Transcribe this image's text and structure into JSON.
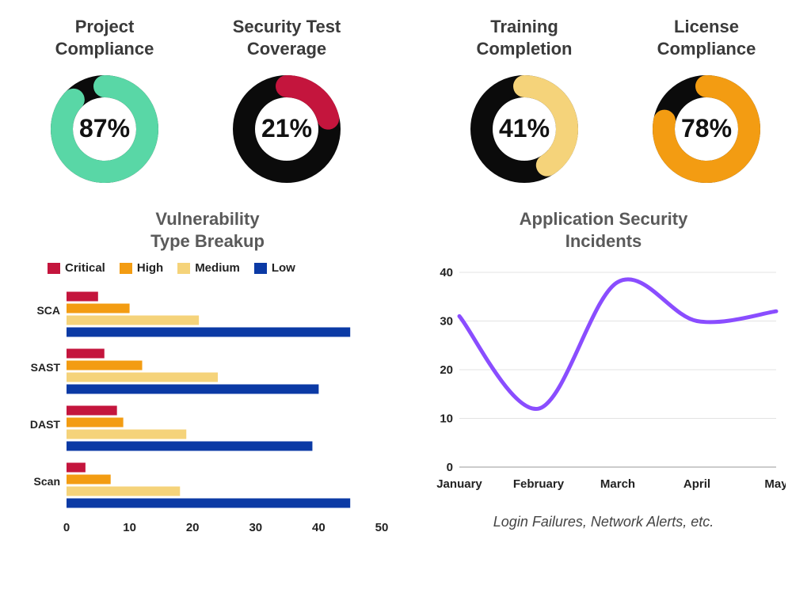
{
  "donuts": [
    {
      "id": "project-compliance",
      "title": "Project\nCompliance",
      "value": 87,
      "color": "#59d7a6"
    },
    {
      "id": "security-coverage",
      "title": "Security Test\nCoverage",
      "value": 21,
      "color": "#c4153d"
    },
    {
      "id": "training-completion",
      "title": "Training\nCompletion",
      "value": 41,
      "color": "#f5d37a"
    },
    {
      "id": "license-compliance",
      "title": "License\nCompliance",
      "value": 78,
      "color": "#f39c12"
    }
  ],
  "vuln": {
    "title": "Vulnerability\nType Breakup",
    "legend": {
      "critical": "Critical",
      "high": "High",
      "medium": "Medium",
      "low": "Low"
    },
    "colors": {
      "critical": "#c4153d",
      "high": "#f39c12",
      "medium": "#f5d37a",
      "low": "#0b3aa5"
    },
    "xmax": 50,
    "xticks": [
      0,
      10,
      20,
      30,
      40,
      50
    ],
    "categories": [
      "SCA",
      "SAST",
      "DAST",
      "Scan"
    ],
    "series": {
      "critical": [
        5,
        6,
        8,
        3
      ],
      "high": [
        10,
        12,
        9,
        7
      ],
      "medium": [
        21,
        24,
        19,
        18
      ],
      "low": [
        45,
        40,
        39,
        45
      ]
    }
  },
  "incidents": {
    "title": "Application Security\nIncidents",
    "yticks": [
      0,
      10,
      20,
      30,
      40
    ],
    "ymax": 40,
    "x": [
      "January",
      "February",
      "March",
      "April",
      "May"
    ],
    "values": [
      31,
      12,
      38,
      30,
      32
    ],
    "color": "#8a4dff",
    "footnote": "Login Failures, Network Alerts, etc."
  },
  "chart_data": [
    {
      "type": "donut",
      "title": "Project Compliance",
      "value": 87,
      "max": 100,
      "unit": "%"
    },
    {
      "type": "donut",
      "title": "Security Test Coverage",
      "value": 21,
      "max": 100,
      "unit": "%"
    },
    {
      "type": "donut",
      "title": "Training Completion",
      "value": 41,
      "max": 100,
      "unit": "%"
    },
    {
      "type": "donut",
      "title": "License Compliance",
      "value": 78,
      "max": 100,
      "unit": "%"
    },
    {
      "type": "bar",
      "orientation": "horizontal",
      "title": "Vulnerability Type Breakup",
      "categories": [
        "SCA",
        "SAST",
        "DAST",
        "Scan"
      ],
      "series": [
        {
          "name": "Critical",
          "values": [
            5,
            6,
            8,
            3
          ]
        },
        {
          "name": "High",
          "values": [
            10,
            12,
            9,
            7
          ]
        },
        {
          "name": "Medium",
          "values": [
            21,
            24,
            19,
            18
          ]
        },
        {
          "name": "Low",
          "values": [
            45,
            40,
            39,
            45
          ]
        }
      ],
      "xlabel": "",
      "ylabel": "",
      "xlim": [
        0,
        50
      ]
    },
    {
      "type": "line",
      "title": "Application Security Incidents",
      "x": [
        "January",
        "February",
        "March",
        "April",
        "May"
      ],
      "series": [
        {
          "name": "Incidents",
          "values": [
            31,
            12,
            38,
            30,
            32
          ]
        }
      ],
      "ylim": [
        0,
        40
      ]
    }
  ]
}
